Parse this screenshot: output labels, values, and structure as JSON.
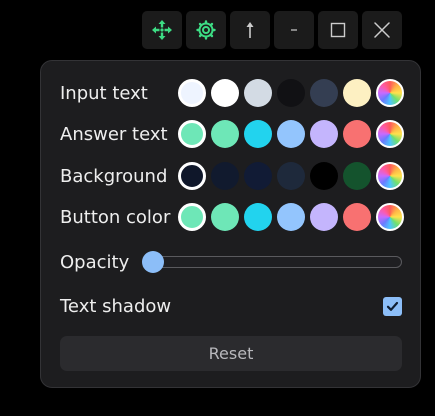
{
  "toolbar": {
    "buttons": [
      {
        "name": "move",
        "icon": "move-icon",
        "color": "#3ddc84"
      },
      {
        "name": "settings",
        "icon": "gear-icon",
        "color": "#3ddc84"
      },
      {
        "name": "pin",
        "icon": "arrow-up-icon",
        "color": "#cccccc"
      },
      {
        "name": "minimize",
        "icon": "minimize-icon",
        "color": "#cccccc"
      },
      {
        "name": "maximize",
        "icon": "maximize-icon",
        "color": "#cccccc"
      },
      {
        "name": "close",
        "icon": "close-icon",
        "color": "#cccccc"
      }
    ]
  },
  "settings": {
    "input_text": {
      "label": "Input text",
      "colors": [
        "#eef4ff",
        "#ffffff",
        "#d3dbe4",
        "#111114",
        "#343e52",
        "#fdf0c2",
        "rainbow"
      ],
      "selected": 0
    },
    "answer_text": {
      "label": "Answer text",
      "colors": [
        "#6ee7b7",
        "#6ee7b7",
        "#22d3ee",
        "#93c5fd",
        "#c4b5fd",
        "#f87171",
        "rainbow"
      ],
      "selected": 0
    },
    "background": {
      "label": "Background",
      "colors": [
        "#0f172a",
        "#111a2e",
        "#111b35",
        "#1e293b",
        "#000000",
        "#14532d",
        "rainbow"
      ],
      "selected": 0
    },
    "button_color": {
      "label": "Button color",
      "colors": [
        "#6ee7b7",
        "#6ee7b7",
        "#22d3ee",
        "#93c5fd",
        "#c4b5fd",
        "#f87171",
        "rainbow"
      ],
      "selected": 0
    },
    "opacity": {
      "label": "Opacity",
      "value": 0.0
    },
    "text_shadow": {
      "label": "Text shadow",
      "checked": true
    },
    "reset_label": "Reset"
  },
  "colors": {
    "accent": "#8cbef8",
    "panel": "#1d1d1f",
    "green_icon": "#3ddc84"
  }
}
